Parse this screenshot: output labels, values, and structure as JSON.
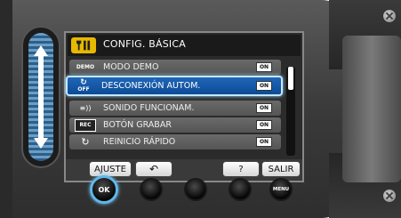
{
  "title": "CONFIG. BÁSICA",
  "title_icon": "tools-icon",
  "menu_items": [
    {
      "icon_text": "DEMO",
      "label": "MODO DEMO",
      "badge": "ON",
      "selected": false
    },
    {
      "icon_text": "OFF",
      "label": "DESCONEXIÓN AUTOM.",
      "badge": "ON",
      "selected": true
    },
    {
      "icon_text": "≡))",
      "label": "SONIDO FUNCIONAM.",
      "badge": "ON",
      "selected": false
    },
    {
      "icon_text": "REC",
      "label": "BOTÓN GRABAR",
      "badge": "ON",
      "selected": false
    },
    {
      "icon_text": "↻",
      "label": "REINICIO RÁPIDO",
      "badge": "ON",
      "selected": false
    }
  ],
  "buttons": {
    "ajuste": "AJUSTE",
    "back": "↶",
    "help": "?",
    "salir": "SALIR"
  },
  "physical_buttons": {
    "ok": "OK",
    "menu": "MENU"
  },
  "colors": {
    "selection": "#1f66b8",
    "selection_border": "#c6e8ff",
    "title_icon_bg": "#e8b800",
    "scroll_bg": "#6a9ec8"
  }
}
